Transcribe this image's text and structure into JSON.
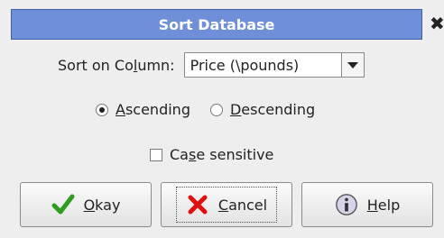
{
  "dialog": {
    "title": "Sort Database",
    "close_glyph": "✖"
  },
  "sort": {
    "label_pre": "Sort on Co",
    "label_u": "l",
    "label_post": "umn:",
    "selected": "Price (\\pounds)",
    "arrow_icon": "chevron-down-icon"
  },
  "order": {
    "ascending": {
      "u": "A",
      "rest": "scending",
      "selected": true
    },
    "descending": {
      "u": "D",
      "rest": "escending",
      "selected": false
    }
  },
  "case": {
    "pre": "Ca",
    "u": "s",
    "post": "e sensitive",
    "checked": false
  },
  "buttons": {
    "okay": {
      "u": "O",
      "rest": "kay",
      "icon": "checkmark-icon",
      "color": "#2e9e1e"
    },
    "cancel": {
      "u": "C",
      "rest": "ancel",
      "icon": "x-icon",
      "color": "#e01010"
    },
    "help": {
      "u": "H",
      "rest": "elp",
      "icon": "info-icon"
    }
  }
}
